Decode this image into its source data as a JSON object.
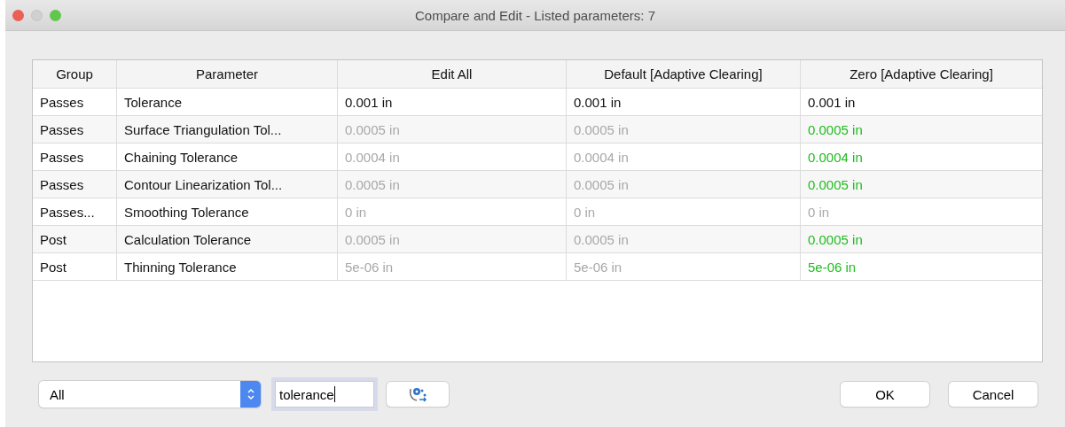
{
  "window": {
    "title": "Compare and Edit - Listed parameters: 7"
  },
  "table": {
    "columns": [
      "Group",
      "Parameter",
      "Edit All",
      "Default [Adaptive Clearing]",
      "Zero [Adaptive Clearing]"
    ],
    "rows": [
      {
        "group": "Passes",
        "parameter": "Tolerance",
        "values": [
          {
            "text": "0.001 in",
            "kind": "normal"
          },
          {
            "text": "0.001 in",
            "kind": "normal"
          },
          {
            "text": "0.001 in",
            "kind": "normal"
          }
        ]
      },
      {
        "group": "Passes",
        "parameter": "Surface Triangulation Tol...",
        "values": [
          {
            "text": "0.0005 in",
            "kind": "default"
          },
          {
            "text": "0.0005 in",
            "kind": "default"
          },
          {
            "text": "0.0005 in",
            "kind": "changed"
          }
        ]
      },
      {
        "group": "Passes",
        "parameter": "Chaining Tolerance",
        "values": [
          {
            "text": "0.0004 in",
            "kind": "default"
          },
          {
            "text": "0.0004 in",
            "kind": "default"
          },
          {
            "text": "0.0004 in",
            "kind": "changed"
          }
        ]
      },
      {
        "group": "Passes",
        "parameter": "Contour Linearization Tol...",
        "values": [
          {
            "text": "0.0005 in",
            "kind": "default"
          },
          {
            "text": "0.0005 in",
            "kind": "default"
          },
          {
            "text": "0.0005 in",
            "kind": "changed"
          }
        ]
      },
      {
        "group": "Passes...",
        "parameter": "Smoothing Tolerance",
        "values": [
          {
            "text": "0 in",
            "kind": "default"
          },
          {
            "text": "0 in",
            "kind": "default"
          },
          {
            "text": "0 in",
            "kind": "default"
          }
        ]
      },
      {
        "group": "Post",
        "parameter": "Calculation Tolerance",
        "values": [
          {
            "text": "0.0005 in",
            "kind": "default"
          },
          {
            "text": "0.0005 in",
            "kind": "default"
          },
          {
            "text": "0.0005 in",
            "kind": "changed"
          }
        ]
      },
      {
        "group": "Post",
        "parameter": "Thinning Tolerance",
        "values": [
          {
            "text": "5e-06 in",
            "kind": "default"
          },
          {
            "text": "5e-06 in",
            "kind": "default"
          },
          {
            "text": "5e-06 in",
            "kind": "changed"
          }
        ]
      }
    ]
  },
  "filter": {
    "value": "All"
  },
  "search": {
    "value": "tolerance"
  },
  "buttons": [
    "OK",
    "Cancel"
  ]
}
